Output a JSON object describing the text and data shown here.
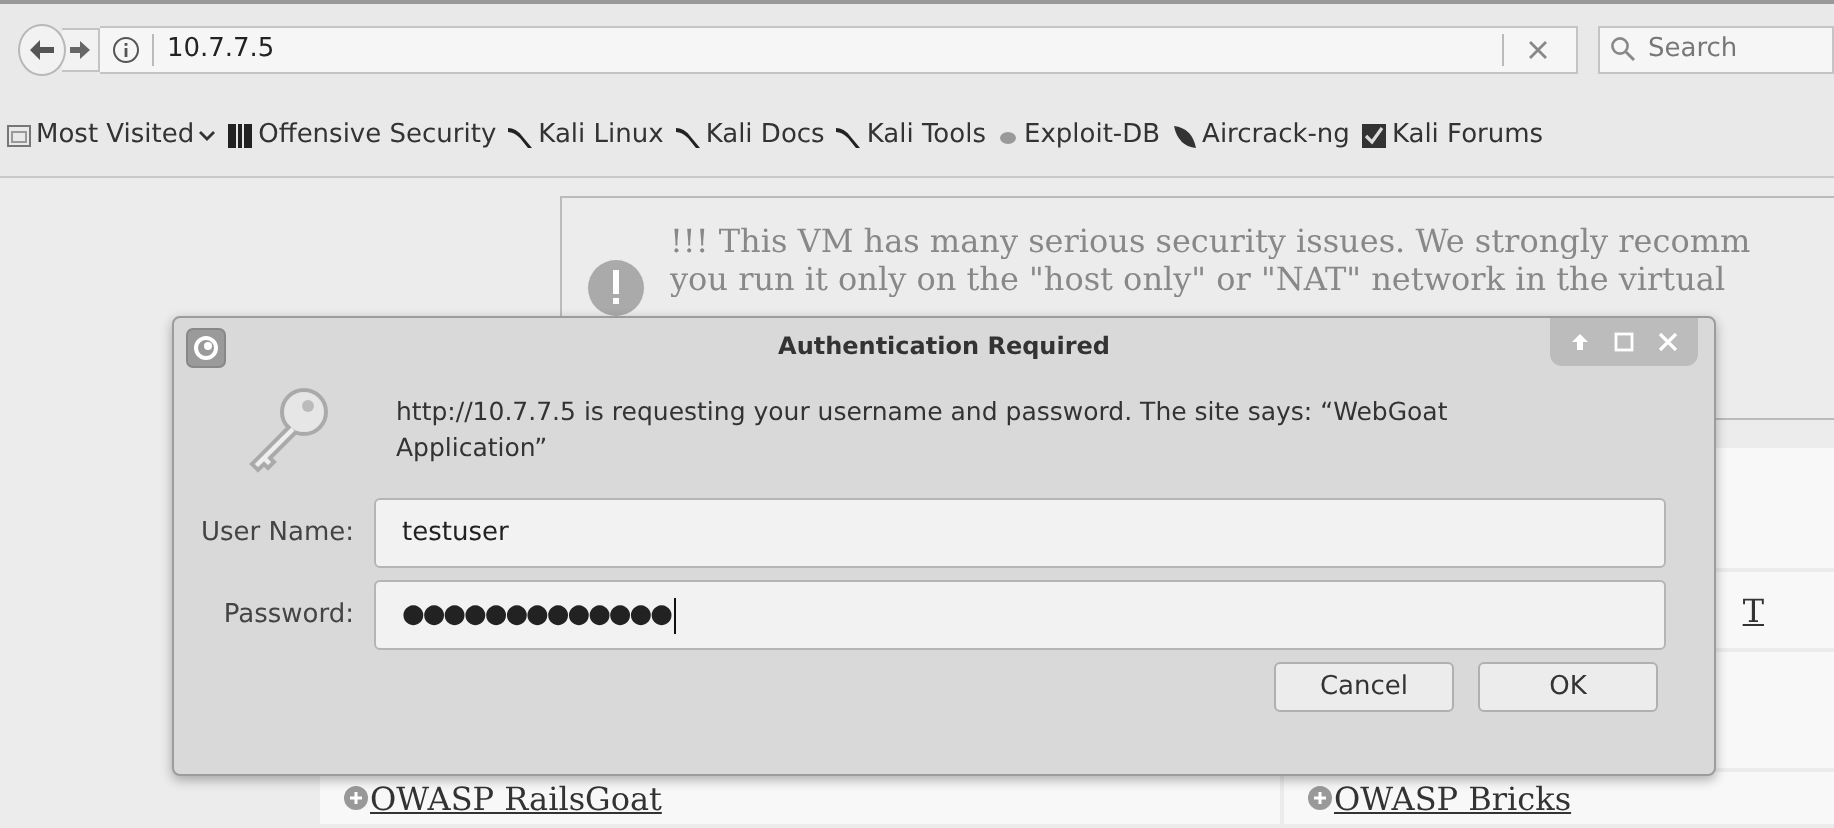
{
  "browser": {
    "address": "10.7.7.5",
    "search_placeholder": "Search",
    "bookmarks": [
      {
        "label": "Most Visited",
        "kind": "menu"
      },
      {
        "label": "Offensive Security",
        "kind": "offsec"
      },
      {
        "label": "Kali Linux",
        "kind": "kali"
      },
      {
        "label": "Kali Docs",
        "kind": "kali"
      },
      {
        "label": "Kali Tools",
        "kind": "kali"
      },
      {
        "label": "Exploit-DB",
        "kind": "bug"
      },
      {
        "label": "Aircrack-ng",
        "kind": "air"
      },
      {
        "label": "Kali Forums",
        "kind": "forum"
      }
    ]
  },
  "page": {
    "notice_lines": [
      "!!! This VM has many serious security issues. We strongly recomm",
      "you run it only on the \"host only\" or \"NAT\" network in the virtual"
    ],
    "partial_link": "T",
    "links": [
      "OWASP RailsGoat",
      "OWASP Bricks"
    ]
  },
  "dialog": {
    "title": "Authentication Required",
    "message": "http://10.7.7.5 is requesting your username and password. The site says: “WebGoat Application”",
    "fields": [
      {
        "label": "User Name:",
        "value": "testuser",
        "kind": "text"
      },
      {
        "label": "Password:",
        "value": "●●●●●●●●●●●●●",
        "kind": "password"
      }
    ],
    "buttons": [
      "Cancel",
      "OK"
    ]
  }
}
